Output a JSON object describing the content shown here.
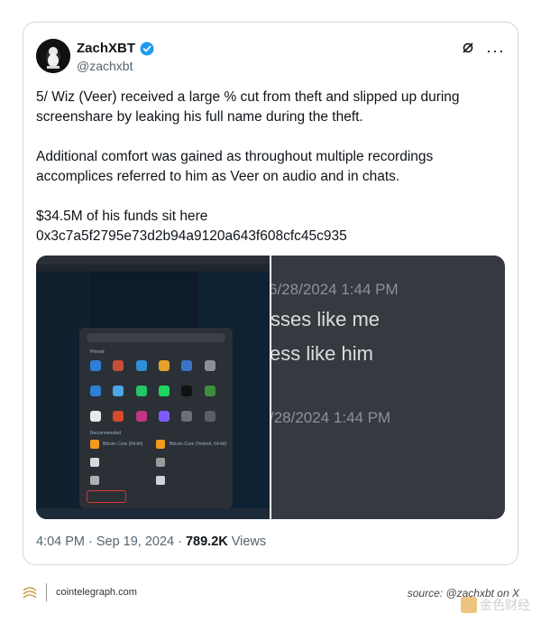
{
  "tweet": {
    "author_name": "ZachXBT",
    "author_handle": "@zachxbt",
    "paragraphs": [
      "5/ Wiz (Veer) received a large % cut from theft and slipped up during screenshare by leaking his full name during the theft.",
      "Additional comfort was gained as throughout multiple recordings accomplices referred to him as Veer on audio and in chats.",
      "$34.5M of his funds sit here\n0x3c7a5f2795e73d2b94a9120a643f608cfc45c935"
    ],
    "time": "4:04 PM",
    "date": "Sep 19, 2024",
    "views_count": "789.2K",
    "views_label": "Views",
    "dot": "·",
    "verified_color": "#1d9bf0",
    "icons": [
      "grok-icon",
      "more-icon",
      "verified-icon"
    ]
  },
  "media": {
    "screenshot_lines": [
      "Bitcoin Core (64-bit)",
      "Bitcoin Core (Testnet, 64-bit)",
      "Recommended",
      "Pinned"
    ],
    "zoom_lines": [
      "6/28/2024 1:44 PM",
      "sses like me",
      "ess like him",
      "/28/2024 1:44 PM"
    ]
  },
  "footer": {
    "publisher": "cointelegraph.com",
    "source_prefix": "source:",
    "source_handle": "@zachxbt on X",
    "watermark": "金色财经"
  }
}
